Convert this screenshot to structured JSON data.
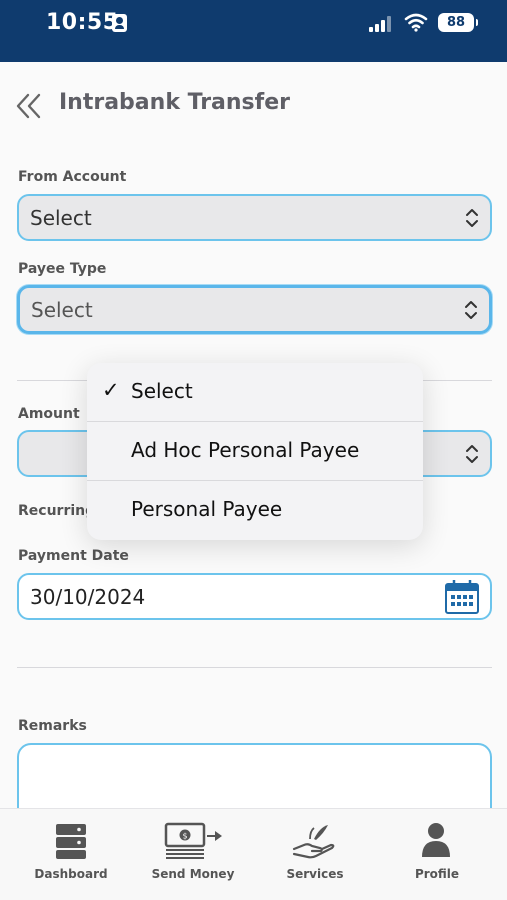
{
  "status_bar": {
    "time": "10:55",
    "battery": "88"
  },
  "header": {
    "title": "Intrabank Transfer"
  },
  "form": {
    "from_account": {
      "label": "From Account",
      "value": "Select"
    },
    "payee_type": {
      "label": "Payee Type",
      "value": "Select"
    },
    "amount": {
      "label": "Amount",
      "value": ""
    },
    "recurring": {
      "label": "Recurring"
    },
    "payment_date": {
      "label": "Payment Date",
      "value": "30/10/2024"
    },
    "remarks": {
      "label": "Remarks",
      "value": ""
    }
  },
  "dropdown": {
    "options": [
      {
        "label": "Select",
        "selected": true,
        "check": "✓"
      },
      {
        "label": "Ad Hoc Personal Payee",
        "selected": false
      },
      {
        "label": "Personal Payee",
        "selected": false
      }
    ]
  },
  "tab_bar": {
    "tabs": [
      {
        "label": "Dashboard",
        "icon": "dashboard-icon"
      },
      {
        "label": "Send Money",
        "icon": "send-money-icon"
      },
      {
        "label": "Services",
        "icon": "services-icon"
      },
      {
        "label": "Profile",
        "icon": "profile-icon"
      }
    ]
  },
  "colors": {
    "status_bar": "#0f3b6e",
    "field_border": "#6cc4ec",
    "text_gray": "#5f5f66"
  }
}
